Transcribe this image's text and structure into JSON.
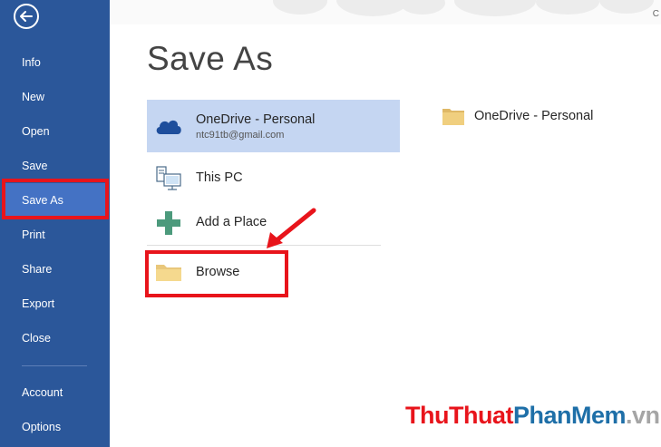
{
  "sidebar": {
    "back_icon": "back-arrow-icon",
    "items": [
      {
        "id": "info",
        "label": "Info"
      },
      {
        "id": "new",
        "label": "New"
      },
      {
        "id": "open",
        "label": "Open"
      },
      {
        "id": "save",
        "label": "Save"
      },
      {
        "id": "save-as",
        "label": "Save As"
      },
      {
        "id": "print",
        "label": "Print"
      },
      {
        "id": "share",
        "label": "Share"
      },
      {
        "id": "export",
        "label": "Export"
      },
      {
        "id": "close",
        "label": "Close"
      },
      {
        "id": "account",
        "label": "Account"
      },
      {
        "id": "options",
        "label": "Options"
      }
    ],
    "active": "Save As"
  },
  "header": {
    "user_initial": "C"
  },
  "main": {
    "title": "Save As",
    "locations": [
      {
        "name": "OneDrive - Personal",
        "sub": "ntc91tb@gmail.com",
        "icon": "cloud-icon",
        "selected": true
      },
      {
        "name": "This PC",
        "icon": "computer-icon"
      },
      {
        "name": "Add a Place",
        "icon": "plus-icon"
      },
      {
        "name": "Browse",
        "icon": "folder-icon"
      }
    ],
    "recent_folders": [
      {
        "name": "OneDrive - Personal",
        "icon": "folder-icon"
      }
    ]
  },
  "watermark": {
    "part1": "Thu",
    "part2": "Thuat",
    "part3": "Phan",
    "part4": "Mem",
    "part5": ".vn"
  },
  "colors": {
    "sidebar": "#2b579a",
    "active_item": "#4472c4",
    "selected_location": "#c5d6f2",
    "highlight": "#e8141b"
  }
}
